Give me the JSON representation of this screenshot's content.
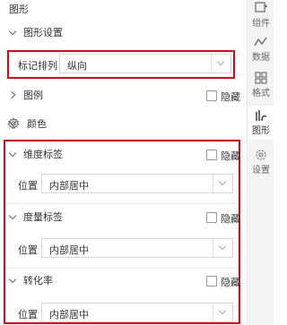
{
  "panel": {
    "title": "图形",
    "shape_settings": {
      "header": "图形设置",
      "marker_arrangement": {
        "label": "标记排列",
        "value": "纵向"
      }
    },
    "legend": {
      "header": "图例",
      "hide_label": "隐藏"
    },
    "color": {
      "header": "颜色"
    },
    "dimension_label": {
      "header": "维度标签",
      "hide_label": "隐藏",
      "position_label": "位置",
      "position_value": "内部居中"
    },
    "measure_label": {
      "header": "度量标签",
      "hide_label": "隐藏",
      "position_label": "位置",
      "position_value": "内部居中"
    },
    "conversion_rate": {
      "header": "转化率",
      "hide_label": "隐藏",
      "position_label": "位置",
      "position_value": "内部居中"
    }
  },
  "rail": {
    "items": [
      {
        "label": "组件",
        "icon": "component-icon"
      },
      {
        "label": "数据",
        "icon": "data-icon"
      },
      {
        "label": "格式",
        "icon": "format-icon"
      },
      {
        "label": "图形",
        "icon": "shape-icon"
      },
      {
        "label": "设置",
        "icon": "gear-icon"
      }
    ],
    "active": "图形"
  },
  "colors": {
    "highlight_border": "#e60012"
  }
}
